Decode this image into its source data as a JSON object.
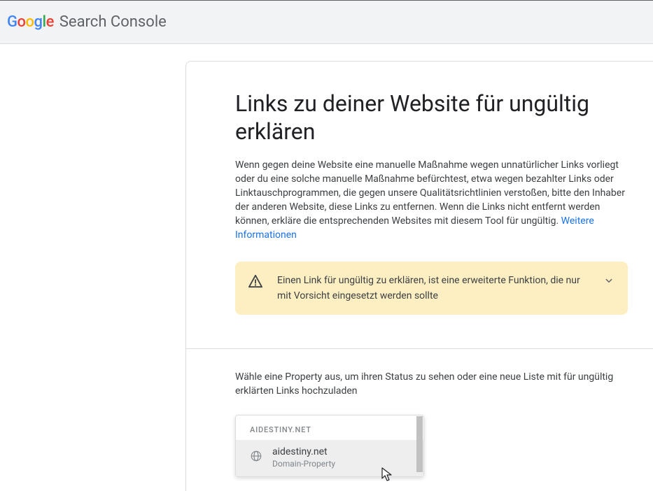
{
  "logo": {
    "product_name": "Search Console"
  },
  "page": {
    "title": "Links zu deiner Website für ungültig erklären",
    "description": "Wenn gegen deine Website eine manuelle Maßnahme wegen unnatürlicher Links vorliegt oder du eine solche manuelle Maßnahme befürchtest, etwa wegen bezahlter Links oder Linktauschprogrammen, die gegen unsere Qualitätsrichtlinien verstoßen, bitte den Inhaber der anderen Website, diese Links zu entfernen. Wenn die Links nicht entfernt werden können, erkläre die entsprechenden Websites mit diesem Tool für ungültig. ",
    "more_info_link": "Weitere Informationen"
  },
  "warning": {
    "text": "Einen Link für ungültig zu erklären, ist eine erweiterte Funktion, die nur mit Vorsicht eingesetzt werden sollte"
  },
  "selector": {
    "label": "Wähle eine Property aus, um ihren Status zu sehen oder eine neue Liste mit für ungültig erklärten Links hochzuladen",
    "group_header": "AIDESTINY.NET",
    "option": {
      "title": "aidestiny.net",
      "subtitle": "Domain-Property"
    }
  }
}
